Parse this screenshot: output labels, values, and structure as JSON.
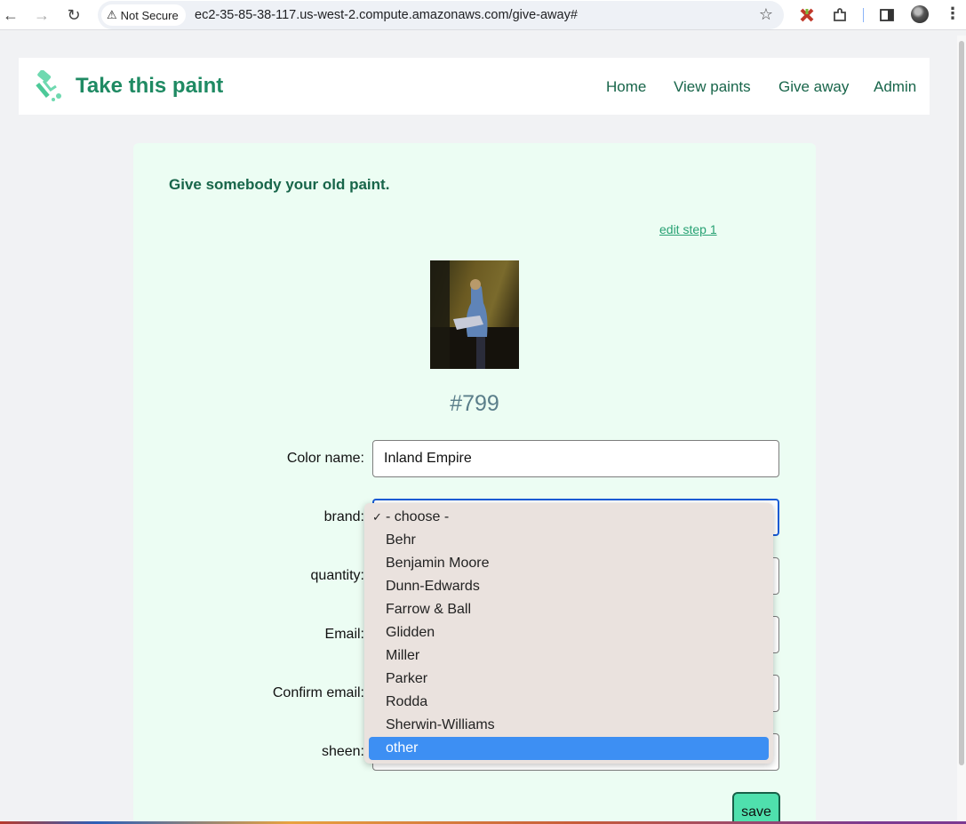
{
  "browser": {
    "security_label": "Not Secure",
    "url": "ec2-35-85-38-117.us-west-2.compute.amazonaws.com/give-away#"
  },
  "site": {
    "title": "Take this paint",
    "nav": [
      "Home",
      "View paints",
      "Give away",
      "Admin"
    ]
  },
  "card": {
    "heading": "Give somebody your old paint.",
    "edit_link": "edit step 1",
    "paint_number": "#799"
  },
  "form": {
    "color_name_label": "Color name:",
    "color_name_value": "Inland Empire",
    "brand_label": "brand:",
    "quantity_label": "quantity:",
    "email_label": "Email:",
    "confirm_email_label": "Confirm email:",
    "sheen_label": "sheen:",
    "save_label": "save"
  },
  "brand_dropdown": {
    "options": [
      "- choose -",
      "Behr",
      "Benjamin Moore",
      "Dunn-Edwards",
      "Farrow & Ball",
      "Glidden",
      "Miller",
      "Parker",
      "Rodda",
      "Sherwin-Williams",
      "other"
    ],
    "checked": "- choose -",
    "highlighted": "other"
  },
  "colors": {
    "brand_green": "#1f8a63",
    "nav_green": "#18654a",
    "card_bg": "#ecfdf3",
    "highlight_blue": "#3d8ff3",
    "save_bg": "#4fe0ad"
  }
}
